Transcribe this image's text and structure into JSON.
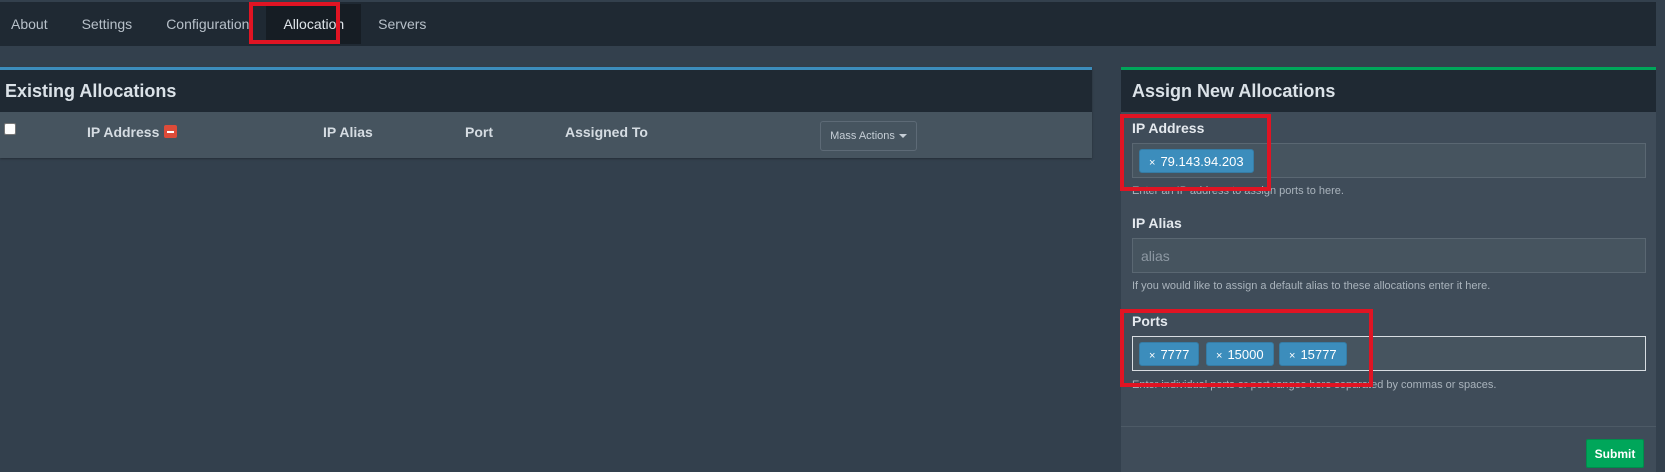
{
  "tabs": [
    {
      "label": "About"
    },
    {
      "label": "Settings"
    },
    {
      "label": "Configuration"
    },
    {
      "label": "Allocation"
    },
    {
      "label": "Servers"
    }
  ],
  "existing": {
    "title": "Existing Allocations",
    "columns": {
      "ip": "IP Address",
      "alias": "IP Alias",
      "port": "Port",
      "assigned": "Assigned To"
    },
    "mass_actions": "Mass Actions"
  },
  "assign": {
    "title": "Assign New Allocations",
    "ip_label": "IP Address",
    "ip_tags": [
      "79.143.94.203"
    ],
    "ip_help": "Enter an IP address to assign ports to here.",
    "alias_label": "IP Alias",
    "alias_placeholder": "alias",
    "alias_help": "If you would like to assign a default alias to these allocations enter it here.",
    "ports_label": "Ports",
    "port_tags": [
      "7777",
      "15000",
      "15777"
    ],
    "ports_help": "Enter individual ports or port ranges here separated by commas or spaces.",
    "submit": "Submit"
  },
  "colors": {
    "accent_blue": "#3c8dbc",
    "accent_green": "#00a65a",
    "highlight_red": "#e01423"
  }
}
